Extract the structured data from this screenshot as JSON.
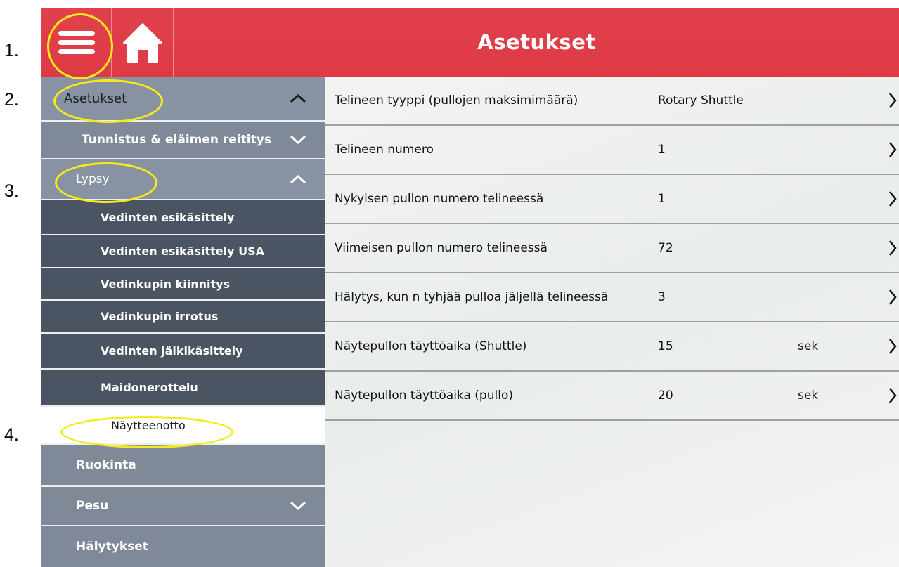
{
  "step_labels": [
    "1.",
    "2.",
    "3.",
    "4."
  ],
  "header": {
    "title": "Asetukset",
    "menu_icon": "hamburger-menu-icon",
    "home_icon": "home-icon",
    "color": "#de3b46"
  },
  "sidebar": {
    "asetukset": "Asetukset",
    "tunnistus": "Tunnistus & eläimen reititys",
    "lypsy": "Lypsy",
    "lypsy_items": [
      "Vedinten esikäsittely",
      "Vedinten esikäsittely USA",
      "Vedinkupin kiinnitys",
      "Vedinkupin irrotus",
      "Vedinten jälkikäsittely",
      "Maidonerottelu"
    ],
    "selected": "Näytteenotto",
    "ruokinta": "Ruokinta",
    "pesu": "Pesu",
    "halytykset": "Hälytykset"
  },
  "settings": [
    {
      "name": "Telineen tyyppi (pullojen maksimimäärä)",
      "value": "Rotary Shuttle",
      "unit": ""
    },
    {
      "name": "Telineen numero",
      "value": "1",
      "unit": ""
    },
    {
      "name": "Nykyisen pullon numero telineessä",
      "value": "1",
      "unit": ""
    },
    {
      "name": "Viimeisen pullon numero telineessä",
      "value": "72",
      "unit": ""
    },
    {
      "name": "Hälytys, kun n tyhjää pulloa jäljellä telineessä",
      "value": "3",
      "unit": ""
    },
    {
      "name": "Näytepullon täyttöaika (Shuttle)",
      "value": "15",
      "unit": "sek"
    },
    {
      "name": "Näytepullon täyttöaika (pullo)",
      "value": "20",
      "unit": "sek"
    }
  ],
  "highlight_color": "#f7ea1a"
}
